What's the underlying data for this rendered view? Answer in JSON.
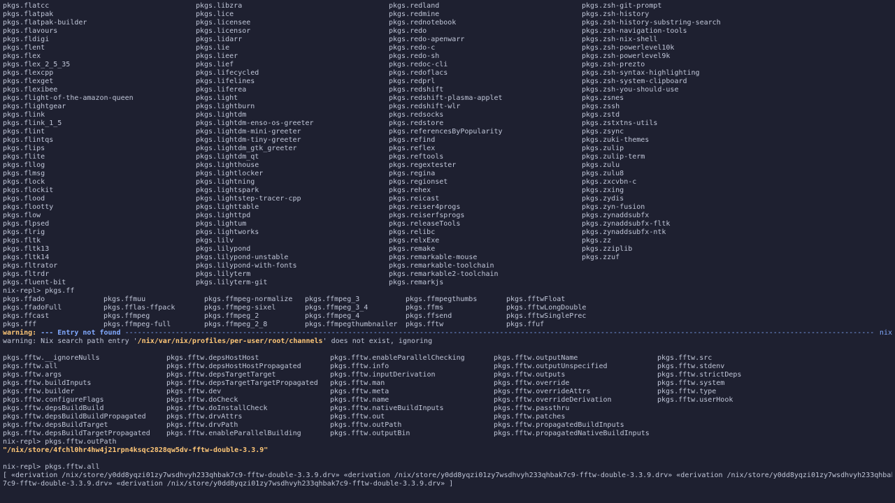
{
  "columns_block1": [
    [
      "pkgs.flatcc",
      "pkgs.flatpak",
      "pkgs.flatpak-builder",
      "pkgs.flavours",
      "pkgs.fldigi",
      "pkgs.flent",
      "pkgs.flex",
      "pkgs.flex_2_5_35",
      "pkgs.flexcpp",
      "pkgs.flexget",
      "pkgs.flexibee",
      "pkgs.flight-of-the-amazon-queen",
      "pkgs.flightgear",
      "pkgs.flink",
      "pkgs.flink_1_5",
      "pkgs.flint",
      "pkgs.flintqs",
      "pkgs.flips",
      "pkgs.flite",
      "pkgs.fllog",
      "pkgs.flmsg",
      "pkgs.flock",
      "pkgs.flockit",
      "pkgs.flood",
      "pkgs.flootty",
      "pkgs.flow",
      "pkgs.flpsed",
      "pkgs.flrig",
      "pkgs.fltk",
      "pkgs.fltk13",
      "pkgs.fltk14",
      "pkgs.fltrator",
      "pkgs.fltrdr",
      "pkgs.fluent-bit"
    ],
    [
      "pkgs.libzra",
      "pkgs.lice",
      "pkgs.licensee",
      "pkgs.licensor",
      "pkgs.lidarr",
      "pkgs.lie",
      "pkgs.lieer",
      "pkgs.lief",
      "pkgs.lifecycled",
      "pkgs.lifelines",
      "pkgs.liferea",
      "pkgs.light",
      "pkgs.lightburn",
      "pkgs.lightdm",
      "pkgs.lightdm-enso-os-greeter",
      "pkgs.lightdm-mini-greeter",
      "pkgs.lightdm-tiny-greeter",
      "pkgs.lightdm_gtk_greeter",
      "pkgs.lightdm_qt",
      "pkgs.lighthouse",
      "pkgs.lightlocker",
      "pkgs.lightning",
      "pkgs.lightspark",
      "pkgs.lightstep-tracer-cpp",
      "pkgs.lighttable",
      "pkgs.lighttpd",
      "pkgs.lightum",
      "pkgs.lightworks",
      "pkgs.lilv",
      "pkgs.lilypond",
      "pkgs.lilypond-unstable",
      "pkgs.lilypond-with-fonts",
      "pkgs.lilyterm",
      "pkgs.lilyterm-git"
    ],
    [
      "pkgs.redland",
      "pkgs.redmine",
      "pkgs.rednotebook",
      "pkgs.redo",
      "pkgs.redo-apenwarr",
      "pkgs.redo-c",
      "pkgs.redo-sh",
      "pkgs.redoc-cli",
      "pkgs.redoflacs",
      "pkgs.redprl",
      "pkgs.redshift",
      "pkgs.redshift-plasma-applet",
      "pkgs.redshift-wlr",
      "pkgs.redsocks",
      "pkgs.redstore",
      "pkgs.referencesByPopularity",
      "pkgs.refind",
      "pkgs.reflex",
      "pkgs.reftools",
      "pkgs.regextester",
      "pkgs.regina",
      "pkgs.regionset",
      "pkgs.rehex",
      "pkgs.reicast",
      "pkgs.reiser4progs",
      "pkgs.reiserfsprogs",
      "pkgs.releaseTools",
      "pkgs.relibc",
      "pkgs.relxExe",
      "pkgs.remake",
      "pkgs.remarkable-mouse",
      "pkgs.remarkable-toolchain",
      "pkgs.remarkable2-toolchain",
      "pkgs.remarkjs"
    ],
    [
      "pkgs.zsh-git-prompt",
      "pkgs.zsh-history",
      "pkgs.zsh-history-substring-search",
      "pkgs.zsh-navigation-tools",
      "pkgs.zsh-nix-shell",
      "pkgs.zsh-powerlevel10k",
      "pkgs.zsh-powerlevel9k",
      "pkgs.zsh-prezto",
      "pkgs.zsh-syntax-highlighting",
      "pkgs.zsh-system-clipboard",
      "pkgs.zsh-you-should-use",
      "pkgs.zsnes",
      "pkgs.zssh",
      "pkgs.zstd",
      "pkgs.zstxtns-utils",
      "pkgs.zsync",
      "pkgs.zuki-themes",
      "pkgs.zulip",
      "pkgs.zulip-term",
      "pkgs.zulu",
      "pkgs.zulu8",
      "pkgs.zxcvbn-c",
      "pkgs.zxing",
      "pkgs.zydis",
      "pkgs.zyn-fusion",
      "pkgs.zynaddsubfx",
      "pkgs.zynaddsubfx-fltk",
      "pkgs.zynaddsubfx-ntk",
      "pkgs.zz",
      "pkgs.zziplib",
      "pkgs.zzuf"
    ]
  ],
  "prompt1": "nix-repl> pkgs.ff",
  "ff_rows": [
    [
      "pkgs.ffado",
      "pkgs.ffmuu",
      "pkgs.ffmpeg-normalize",
      "pkgs.ffmpeg_3",
      "pkgs.ffmpegthumbs",
      "pkgs.fftwFloat"
    ],
    [
      "pkgs.ffadoFull",
      "pkgs.fflas-ffpack",
      "pkgs.ffmpeg-sixel",
      "pkgs.ffmpeg_3_4",
      "pkgs.ffms",
      "pkgs.fftwLongDouble"
    ],
    [
      "pkgs.ffcast",
      "pkgs.ffmpeg",
      "pkgs.ffmpeg_2",
      "pkgs.ffmpeg_4",
      "pkgs.ffsend",
      "pkgs.fftwSinglePrec"
    ],
    [
      "pkgs.fff",
      "pkgs.ffmpeg-full",
      "pkgs.ffmpeg_2_8",
      "pkgs.ffmpegthumbnailer",
      "pkgs.fftw",
      "pkgs.ffuf"
    ]
  ],
  "warning_banner": {
    "label": "warning:",
    "title": " --- Entry not found ",
    "tag": " nix"
  },
  "warning2": {
    "prefix": "warning: Nix search path entry '",
    "path": "/nix/var/nix/profiles/per-user/root/channels",
    "suffix": "' does not exist, ignoring"
  },
  "fftw_rows": [
    [
      "pkgs.fftw.__ignoreNulls",
      "pkgs.fftw.depsHostHost",
      "pkgs.fftw.enableParallelChecking",
      "pkgs.fftw.outputName",
      "pkgs.fftw.src"
    ],
    [
      "pkgs.fftw.all",
      "pkgs.fftw.depsHostHostPropagated",
      "pkgs.fftw.info",
      "pkgs.fftw.outputUnspecified",
      "pkgs.fftw.stdenv"
    ],
    [
      "pkgs.fftw.args",
      "pkgs.fftw.depsTargetTarget",
      "pkgs.fftw.inputDerivation",
      "pkgs.fftw.outputs",
      "pkgs.fftw.strictDeps"
    ],
    [
      "pkgs.fftw.buildInputs",
      "pkgs.fftw.depsTargetTargetPropagated",
      "pkgs.fftw.man",
      "pkgs.fftw.override",
      "pkgs.fftw.system"
    ],
    [
      "pkgs.fftw.builder",
      "pkgs.fftw.dev",
      "pkgs.fftw.meta",
      "pkgs.fftw.overrideAttrs",
      "pkgs.fftw.type"
    ],
    [
      "pkgs.fftw.configureFlags",
      "pkgs.fftw.doCheck",
      "pkgs.fftw.name",
      "pkgs.fftw.overrideDerivation",
      "pkgs.fftw.userHook"
    ],
    [
      "pkgs.fftw.depsBuildBuild",
      "pkgs.fftw.doInstallCheck",
      "pkgs.fftw.nativeBuildInputs",
      "pkgs.fftw.passthru",
      ""
    ],
    [
      "pkgs.fftw.depsBuildBuildPropagated",
      "pkgs.fftw.drvAttrs",
      "pkgs.fftw.out",
      "pkgs.fftw.patches",
      ""
    ],
    [
      "pkgs.fftw.depsBuildTarget",
      "pkgs.fftw.drvPath",
      "pkgs.fftw.outPath",
      "pkgs.fftw.propagatedBuildInputs",
      ""
    ],
    [
      "pkgs.fftw.depsBuildTargetPropagated",
      "pkgs.fftw.enableParallelBuilding",
      "pkgs.fftw.outputBin",
      "pkgs.fftw.propagatedNativeBuildInputs",
      ""
    ]
  ],
  "prompt2": "nix-repl> pkgs.fftw.outPath",
  "outpath_result": "\"/nix/store/4fchl0hr4hw4j21rpn4ksqc2828qw5dv-fftw-double-3.3.9\"",
  "prompt3": "nix-repl> pkgs.fftw.all",
  "all_result_line1": "[ «derivation /nix/store/y0dd8yqzi01zy7wsdhvyh233qhbak7c9-fftw-double-3.3.9.drv» «derivation /nix/store/y0dd8yqzi01zy7wsdhvyh233qhbak7c9-fftw-double-3.3.9.drv» «derivation /nix/store/y0dd8yqzi01zy7wsdhvyh233qhbak",
  "all_result_line2": "7c9-fftw-double-3.3.9.drv» «derivation /nix/store/y0dd8yqzi01zy7wsdhvyh233qhbak7c9-fftw-double-3.3.9.drv» ]",
  "colors": {
    "background": "#1e2030",
    "foreground": "#c0c6d8",
    "warning_yellow": "#ffc777",
    "accent_blue": "#82aaff"
  }
}
